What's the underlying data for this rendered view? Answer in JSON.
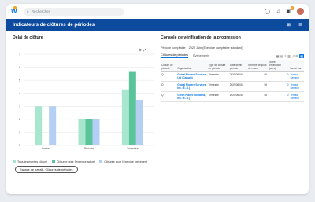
{
  "topbar": {
    "search_placeholder": "Rechercher",
    "notification_badge": "1"
  },
  "header": {
    "title": "Indicateurs de clôtures de périodes"
  },
  "delay": {
    "title": "Délai de clôture"
  },
  "chart_data": {
    "type": "bar",
    "categories": [
      "Année",
      "Période",
      "Trimestre"
    ],
    "series": [
      {
        "name": "Tous les entrées clôturé",
        "color": "#a8e6cf",
        "values": [
          3.0,
          2.0,
          4.3
        ]
      },
      {
        "name": "Clôturée pour l'exercice actuel",
        "color": "#5cc49a",
        "values": [
          0,
          2.0,
          5.7
        ]
      },
      {
        "name": "Clôturée pour l'exercice précédent",
        "color": "#b3cff4",
        "values": [
          3.0,
          2.0,
          3.5
        ]
      }
    ],
    "ylim": [
      0,
      7
    ],
    "yticks": [
      0,
      1,
      2,
      3,
      4,
      5,
      6,
      7
    ],
    "legend": "bottom"
  },
  "workspace_button": "Espace de travail - Clôtures de périodes",
  "progress": {
    "title": "Console de vérification de la progression",
    "period_label": "Période comptable",
    "period_value": "2025 Juin (Exercice comptable standard)",
    "tab_active": "Clôtures de périodes",
    "tab_other": "Événements",
    "columns": [
      "Clôture de période",
      "Organisation",
      "Type de clôture de période",
      "Date de fin période",
      "Nombre de jours de retard",
      "Durée d'exécution (jours)",
      "Lancé par"
    ],
    "rows": [
      [
        "Q",
        "Global Modern Services, Ltd (Canada)",
        "Trimestre",
        "2025/06/06",
        "56",
        "0",
        "Teresa Serrano"
      ],
      [
        "Q",
        "Global Modern Services, Inc. (É.-U.)",
        "Trimestre",
        "2025/06/06",
        "56",
        "0",
        "Teresa Serrano"
      ],
      [
        "Q",
        "Green Planet Solutions, Inc. (É.-U.)",
        "Trimestre",
        "2025/06/06",
        "56",
        "0",
        "Teresa Serrano"
      ]
    ]
  }
}
